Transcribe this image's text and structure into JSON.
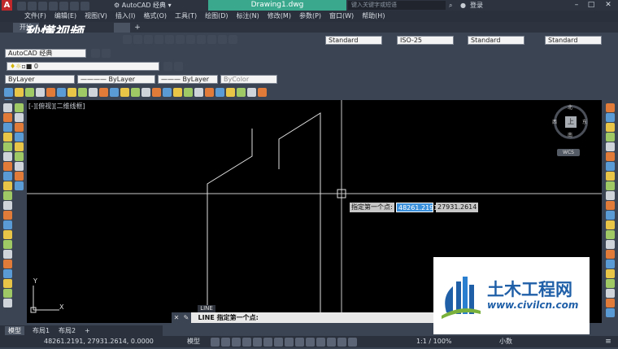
{
  "title_bar": {
    "workspace": "AutoCAD 经典",
    "document": "Drawing1.dwg",
    "search_placeholder": "键入关键字或短语",
    "login": "登录",
    "app_letter": "A"
  },
  "menu": [
    "文件(F)",
    "编辑(E)",
    "视图(V)",
    "插入(I)",
    "格式(O)",
    "工具(T)",
    "绘图(D)",
    "标注(N)",
    "修改(M)",
    "参数(P)",
    "窗口(W)",
    "帮助(H)"
  ],
  "watermark_text": "秒懂视频",
  "doc_tab_start": "开始",
  "toolbar": {
    "workspace_select": "AutoCAD 经典",
    "text_style": "Standard",
    "dim_style": "ISO-25",
    "table_style": "Standard",
    "multileader_style": "Standard",
    "layer_name": "0",
    "color": "ByLayer",
    "linetype": "ByLayer",
    "lineweight": "ByLayer",
    "plotstyle": "ByColor"
  },
  "viewport_label": "[-][俯视][二维线框]",
  "viewcube": {
    "north": "北",
    "south": "南",
    "east": "东",
    "west": "西",
    "top": "上",
    "wcs": "WCS"
  },
  "dynamic_input": {
    "prompt": "指定第一个点:",
    "x_value": "48261.2191",
    "y_value": "27931.2614"
  },
  "ucs": {
    "x": "X",
    "y": "Y"
  },
  "command": {
    "tooltip": "LINE",
    "line": "LINE 指定第一个点:"
  },
  "layout_tabs": [
    "模型",
    "布局1",
    "布局2"
  ],
  "status": {
    "coords": "48261.2191, 27931.2614, 0.0000",
    "model": "模型",
    "scale": "1:1 / 100%",
    "units": "小数"
  },
  "logo": {
    "name": "土木工程网",
    "url": "www.civilcn.com"
  }
}
